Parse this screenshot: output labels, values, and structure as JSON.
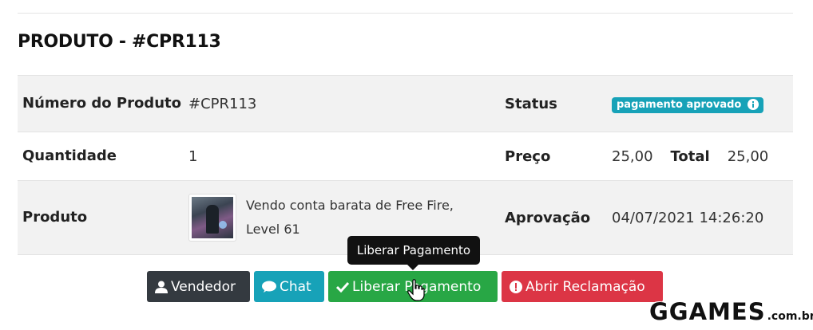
{
  "title": "PRODUTO - #CPR113",
  "rows": {
    "numero_label": "Número do Produto",
    "numero_value": "#CPR113",
    "status_label": "Status",
    "status_badge": "pagamento aprovado",
    "quantidade_label": "Quantidade",
    "quantidade_value": "1",
    "preco_label": "Preço",
    "preco_value": "25,00",
    "total_label": "Total",
    "total_value": "25,00",
    "produto_label": "Produto",
    "produto_name": "Vendo conta barata de Free Fire, Level 61",
    "aprovacao_label": "Aprovação",
    "aprovacao_value": "04/07/2021 14:26:20"
  },
  "tooltip": "Liberar Pagamento",
  "buttons": {
    "seller": "Vendedor",
    "chat": "Chat",
    "release": "Liberar Pagamento",
    "complaint": "Abrir Reclamação"
  },
  "icons": {
    "seller": "user-icon",
    "chat": "comment-icon",
    "release": "check-icon",
    "complaint": "exclamation-circle-icon",
    "status_info": "info-circle-icon"
  },
  "colors": {
    "badge": "#17a2b8",
    "seller": "#343a40",
    "chat": "#17a2b8",
    "release": "#28a745",
    "complaint": "#dc3545"
  },
  "watermark": {
    "main": "GGAMES",
    "tld": ".com.br"
  }
}
